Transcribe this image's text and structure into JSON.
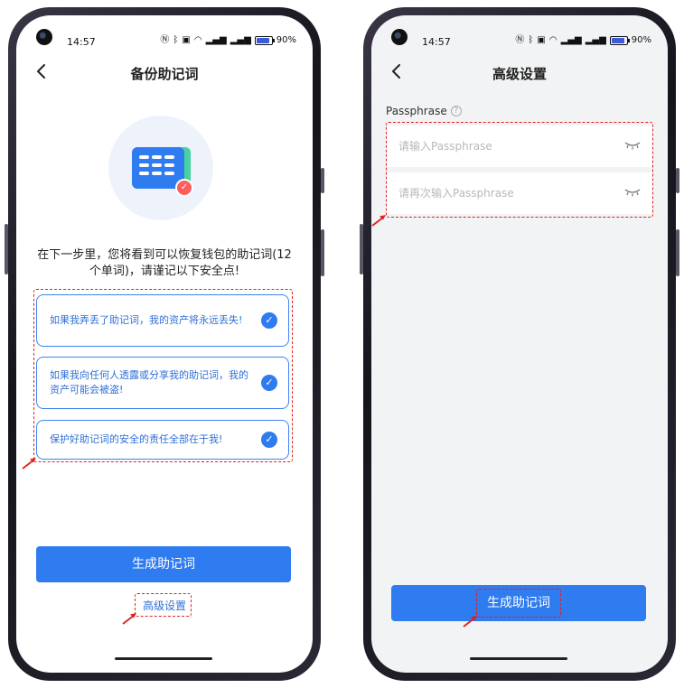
{
  "status": {
    "time": "14:57",
    "battery": "90%",
    "icons": [
      "nfc-icon",
      "bluetooth-icon",
      "hd-icon",
      "wifi-icon",
      "signal-5g-icon",
      "signal-icon",
      "battery-icon"
    ]
  },
  "backup": {
    "title": "备份助记词",
    "intro": "在下一步里，您将看到可以恢复钱包的助记词(12个单词)，请谨记以下安全点!",
    "items": [
      "如果我弄丢了助记词，我的资产将永远丢失!",
      "如果我向任何人透露或分享我的助记词，我的资产可能会被盗!",
      "保护好助记词的安全的责任全部在于我!"
    ],
    "generate_label": "生成助记词",
    "advanced_link": "高级设置"
  },
  "advanced": {
    "title": "高级设置",
    "passphrase_label": "Passphrase",
    "input1_placeholder": "请输入Passphrase",
    "input2_placeholder": "请再次输入Passphrase",
    "generate_label": "生成助记词"
  },
  "colors": {
    "primary": "#2f7bf0",
    "annotation": "#e02020",
    "item_text": "#2f6fd6"
  }
}
